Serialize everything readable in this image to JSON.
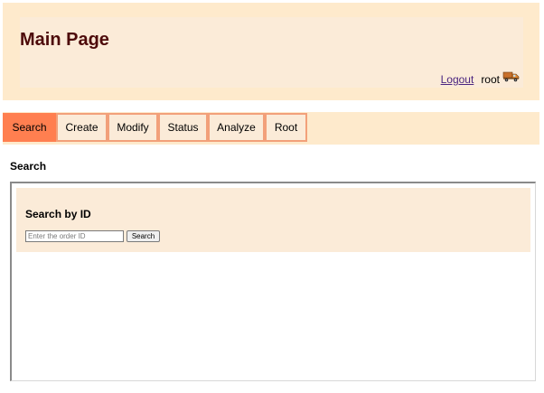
{
  "header": {
    "title": "Main Page",
    "logout_label": "Logout",
    "username": "root"
  },
  "tabs": [
    {
      "label": "Search",
      "active": true
    },
    {
      "label": "Create",
      "active": false
    },
    {
      "label": "Modify",
      "active": false
    },
    {
      "label": "Status",
      "active": false
    },
    {
      "label": "Analyze",
      "active": false
    },
    {
      "label": "Root",
      "active": false
    }
  ],
  "content": {
    "section_title": "Search",
    "panel_title": "Search by ID",
    "input_placeholder": "Enter the order ID",
    "input_value": "",
    "button_label": "Search"
  },
  "colors": {
    "header_bg": "#feeacc",
    "panel_bg": "#fbebd8",
    "active_tab": "#ff7f50",
    "tab_border": "#f2a07a",
    "title_color": "#4d0a0a",
    "link_color": "#4b2580"
  },
  "icons": {
    "user_icon": "truck-icon"
  }
}
